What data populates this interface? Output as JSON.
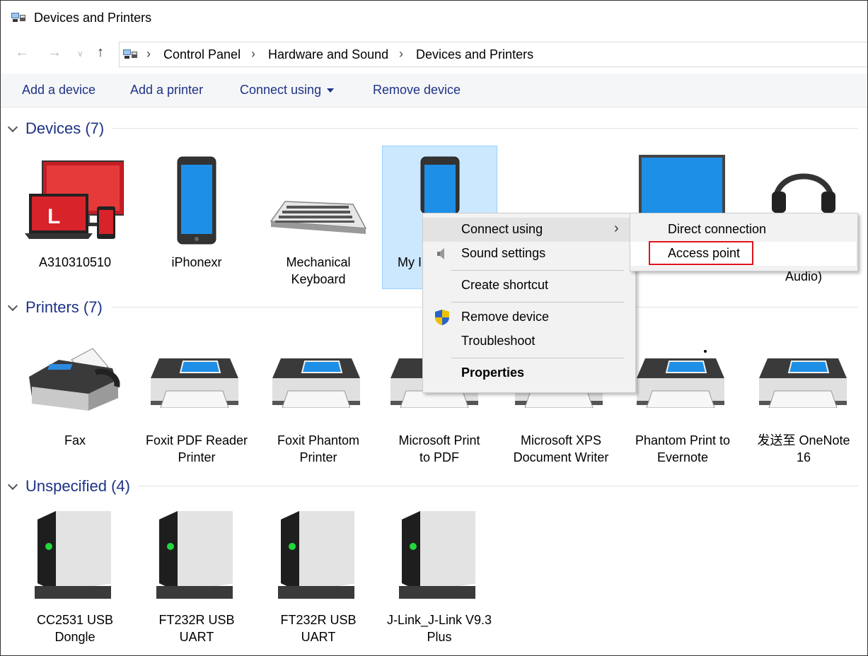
{
  "window": {
    "title": "Devices and Printers"
  },
  "address": {
    "crumbs": [
      "Control Panel",
      "Hardware and Sound",
      "Devices and Printers"
    ]
  },
  "toolbar": {
    "add_device": "Add a device",
    "add_printer": "Add a printer",
    "connect_using": "Connect using",
    "remove_device": "Remove device"
  },
  "groups": {
    "devices": {
      "title": "Devices (7)",
      "items": [
        {
          "line1": "A310310510",
          "line2": ""
        },
        {
          "line1": "iPhonexr",
          "line2": ""
        },
        {
          "line1": "Mechanical",
          "line2": "Keyboard"
        },
        {
          "line1": "My I",
          "line2": ""
        },
        {
          "line1": "",
          "line2": "Audio)"
        }
      ]
    },
    "printers": {
      "title": "Printers (7)",
      "items": [
        {
          "line1": "Fax",
          "line2": ""
        },
        {
          "line1": "Foxit PDF Reader",
          "line2": "Printer"
        },
        {
          "line1": "Foxit Phantom",
          "line2": "Printer"
        },
        {
          "line1": "Microsoft Print",
          "line2": "to PDF"
        },
        {
          "line1": "Microsoft XPS",
          "line2": "Document Writer"
        },
        {
          "line1": "Phantom Print to",
          "line2": "Evernote"
        },
        {
          "line1": "发送至 OneNote",
          "line2": "16"
        }
      ]
    },
    "unspecified": {
      "title": "Unspecified (4)",
      "items": [
        {
          "line1": "CC2531 USB",
          "line2": "Dongle"
        },
        {
          "line1": "FT232R USB UART",
          "line2": ""
        },
        {
          "line1": "FT232R USB UART",
          "line2": ""
        },
        {
          "line1": "J-Link_J-Link V9.3",
          "line2": "Plus"
        }
      ]
    }
  },
  "context_menu": {
    "connect_using": "Connect using",
    "sound_settings": "Sound settings",
    "create_shortcut": "Create shortcut",
    "remove_device": "Remove device",
    "troubleshoot": "Troubleshoot",
    "properties": "Properties"
  },
  "submenu": {
    "direct_connection": "Direct connection",
    "access_point": "Access point"
  },
  "colors": {
    "accent": "#1e3287",
    "selection": "#cce8ff",
    "highlight": "#e0141e"
  }
}
